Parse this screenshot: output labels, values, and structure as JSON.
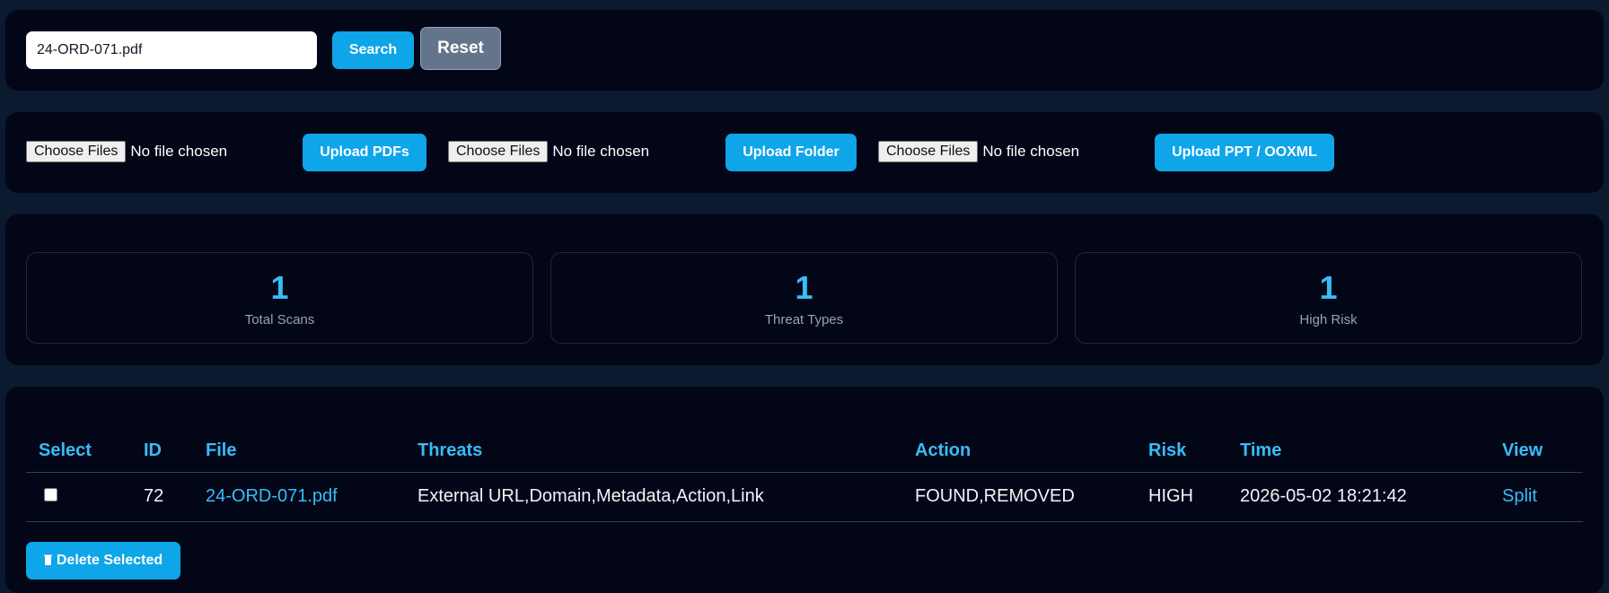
{
  "search": {
    "value": "24-ORD-071.pdf",
    "search_label": "Search",
    "reset_label": "Reset"
  },
  "uploads": [
    {
      "choose_label": "Choose Files",
      "status": "No file chosen",
      "button_label": "Upload PDFs"
    },
    {
      "choose_label": "Choose Files",
      "status": "No file chosen",
      "button_label": "Upload Folder"
    },
    {
      "choose_label": "Choose Files",
      "status": "No file chosen",
      "button_label": "Upload PPT / OOXML"
    }
  ],
  "stats": [
    {
      "value": "1",
      "label": "Total Scans"
    },
    {
      "value": "1",
      "label": "Threat Types"
    },
    {
      "value": "1",
      "label": "High Risk"
    }
  ],
  "table": {
    "headers": [
      "Select",
      "ID",
      "File",
      "Threats",
      "Action",
      "Risk",
      "Time",
      "View"
    ],
    "rows": [
      {
        "id": "72",
        "file": "24-ORD-071.pdf",
        "threats": "External URL,Domain,Metadata,Action,Link",
        "action": "FOUND,REMOVED",
        "risk": "HIGH",
        "time": "2026-05-02 18:21:42",
        "view": "Split",
        "selected": false
      }
    ]
  },
  "delete_label": "Delete Selected",
  "icons": {
    "delete": "trash-icon"
  },
  "colors": {
    "accent": "#0ea5e9",
    "heading": "#38bdf8",
    "panel": "#020617",
    "background": "#0b1a2e",
    "reset": "#64748b"
  }
}
